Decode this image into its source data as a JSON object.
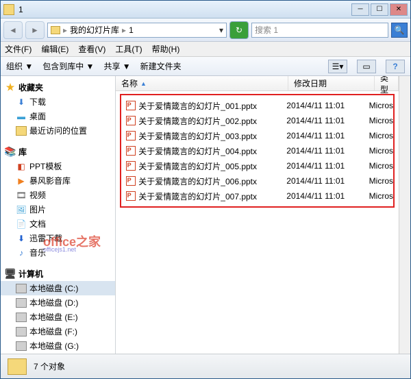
{
  "window": {
    "title": "1"
  },
  "nav": {
    "breadcrumb": [
      "我的幻灯片库",
      "1"
    ],
    "search_placeholder": "搜索 1"
  },
  "menu": {
    "file": "文件(F)",
    "edit": "编辑(E)",
    "view": "查看(V)",
    "tools": "工具(T)",
    "help": "帮助(H)"
  },
  "toolbar": {
    "organize": "组织 ▼",
    "include": "包含到库中 ▼",
    "share": "共享 ▼",
    "newfolder": "新建文件夹"
  },
  "sidebar": {
    "favorites": {
      "label": "收藏夹",
      "items": [
        "下载",
        "桌面",
        "最近访问的位置"
      ]
    },
    "libraries": {
      "label": "库",
      "items": [
        "PPT模板",
        "暴风影音库",
        "视频",
        "图片",
        "文档",
        "迅雷下载",
        "音乐"
      ]
    },
    "computer": {
      "label": "计算机",
      "items": [
        "本地磁盘 (C:)",
        "本地磁盘 (D:)",
        "本地磁盘 (E:)",
        "本地磁盘 (F:)",
        "本地磁盘 (G:)"
      ]
    }
  },
  "columns": {
    "name": "名称",
    "date": "修改日期",
    "type": "类型"
  },
  "files": [
    {
      "name": "关于爱情箴言的幻灯片_001.pptx",
      "date": "2014/4/11 11:01",
      "type": "Micros"
    },
    {
      "name": "关于爱情箴言的幻灯片_002.pptx",
      "date": "2014/4/11 11:01",
      "type": "Micros"
    },
    {
      "name": "关于爱情箴言的幻灯片_003.pptx",
      "date": "2014/4/11 11:01",
      "type": "Micros"
    },
    {
      "name": "关于爱情箴言的幻灯片_004.pptx",
      "date": "2014/4/11 11:01",
      "type": "Micros"
    },
    {
      "name": "关于爱情箴言的幻灯片_005.pptx",
      "date": "2014/4/11 11:01",
      "type": "Micros"
    },
    {
      "name": "关于爱情箴言的幻灯片_006.pptx",
      "date": "2014/4/11 11:01",
      "type": "Micros"
    },
    {
      "name": "关于爱情箴言的幻灯片_007.pptx",
      "date": "2014/4/11 11:01",
      "type": "Micros"
    }
  ],
  "status": {
    "count": "7 个对象"
  },
  "watermark": {
    "main": "office之家",
    "sub": "officejs1.net"
  }
}
